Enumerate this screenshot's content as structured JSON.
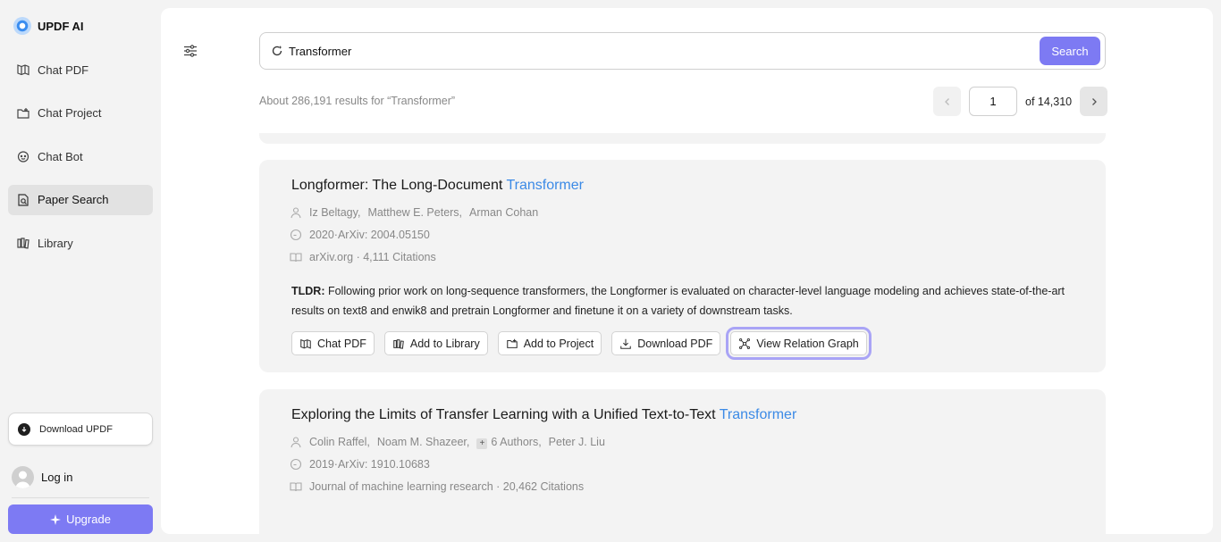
{
  "brand": {
    "name": "UPDF AI"
  },
  "nav": [
    {
      "label": "Chat PDF",
      "icon": "chat-pdf-icon",
      "active": false
    },
    {
      "label": "Chat Project",
      "icon": "folder-icon",
      "active": false
    },
    {
      "label": "Chat Bot",
      "icon": "bot-icon",
      "active": false
    },
    {
      "label": "Paper Search",
      "icon": "paper-search-icon",
      "active": true
    },
    {
      "label": "Library",
      "icon": "library-icon",
      "active": false
    }
  ],
  "sidebar_bottom": {
    "download_label": "Download UPDF",
    "login_label": "Log in",
    "upgrade_label": "Upgrade"
  },
  "search": {
    "value": "Transformer",
    "button_label": "Search"
  },
  "results": {
    "summary": "About 286,191 results for “Transformer”",
    "page": "1",
    "of_pages": "of 14,310"
  },
  "papers": [
    {
      "title_prefix": "Longformer: The Long-Document ",
      "title_highlight": "Transformer",
      "authors": [
        "Iz Beltagy,",
        "Matthew E. Peters,",
        "Arman Cohan"
      ],
      "year_source": "2020·ArXiv: 2004.05150",
      "venue": "arXiv.org · 4,111 Citations",
      "tldr_label": "TLDR:",
      "tldr_text": " Following prior work on long-sequence transformers, the Longformer is evaluated on character-level language modeling and achieves state-of-the-art results on text8 and enwik8 and pretrain Longformer and finetune it on a variety of downstream tasks."
    },
    {
      "title_prefix": "Exploring the Limits of Transfer Learning with a Unified Text-to-Text ",
      "title_highlight": "Transformer",
      "authors": [
        "Colin Raffel,",
        "Noam M. Shazeer,",
        "6 Authors,",
        "Peter J. Liu"
      ],
      "year_source": "2019·ArXiv: 1910.10683",
      "venue": "Journal of machine learning research · 20,462 Citations"
    }
  ],
  "actions": {
    "chat_pdf": "Chat PDF",
    "add_library": "Add to Library",
    "add_project": "Add to Project",
    "download_pdf": "Download PDF",
    "relation_graph": "View Relation Graph"
  },
  "colors": {
    "accent": "#7d7af3",
    "highlight_link": "#3b8ae6",
    "focus_outline": "#a9a4f6"
  }
}
